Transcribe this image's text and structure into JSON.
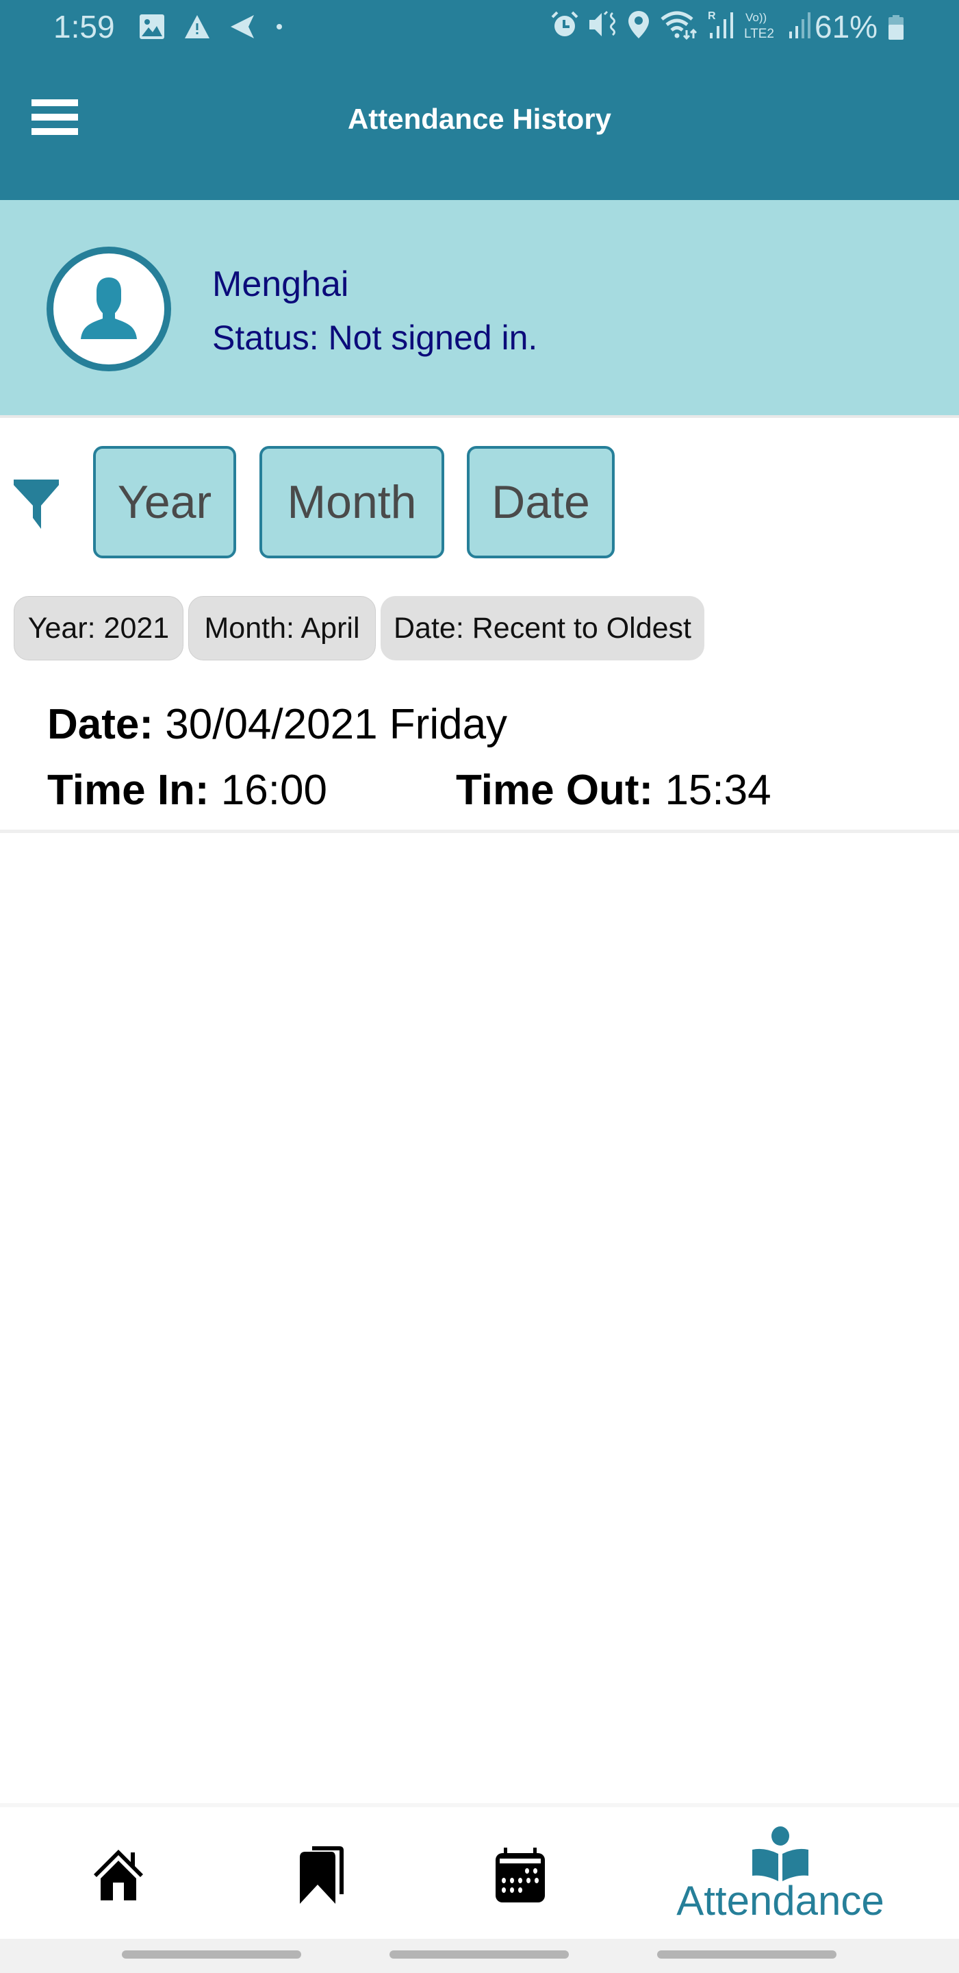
{
  "status_bar": {
    "time": "1:59",
    "left_icons": [
      "gallery-icon",
      "warning-icon",
      "send-icon",
      "dot-icon"
    ],
    "right_icons": [
      "alarm-icon",
      "mute-vibrate-icon",
      "location-icon",
      "wifi-icon",
      "signal-roaming-icon",
      "volte-lte2-icon",
      "signal-icon"
    ],
    "volte_label": "Vo))",
    "lte_label": "LTE2",
    "roaming_label": "R",
    "battery": "61%",
    "battery_level": 0.61
  },
  "app_bar": {
    "title": "Attendance History",
    "menu_icon": "hamburger-menu-icon"
  },
  "profile": {
    "name": "Menghai",
    "status": "Status: Not signed in.",
    "avatar_icon": "user-avatar-icon"
  },
  "filters": {
    "icon": "filter-icon",
    "buttons": [
      {
        "label": "Year"
      },
      {
        "label": "Month"
      },
      {
        "label": "Date"
      }
    ],
    "chips": [
      {
        "label": "Year: 2021"
      },
      {
        "label": "Month: April"
      },
      {
        "label": "Date: Recent to Oldest"
      }
    ]
  },
  "records": [
    {
      "date_label": "Date:",
      "date_value": "30/04/2021 Friday",
      "time_in_label": "Time In:",
      "time_in_value": "16:00",
      "time_out_label": "Time Out:",
      "time_out_value": "15:34"
    }
  ],
  "bottom_nav": {
    "items": [
      {
        "icon": "home-icon",
        "label": ""
      },
      {
        "icon": "bookmarks-icon",
        "label": ""
      },
      {
        "icon": "calendar-icon",
        "label": ""
      },
      {
        "icon": "reading-person-icon",
        "label": "Attendance",
        "active": true
      }
    ]
  },
  "colors": {
    "primary": "#267f99",
    "light_teal": "#a6dbe0",
    "name_text": "#0b0b7a",
    "chip_bg": "#e0e0e0"
  }
}
